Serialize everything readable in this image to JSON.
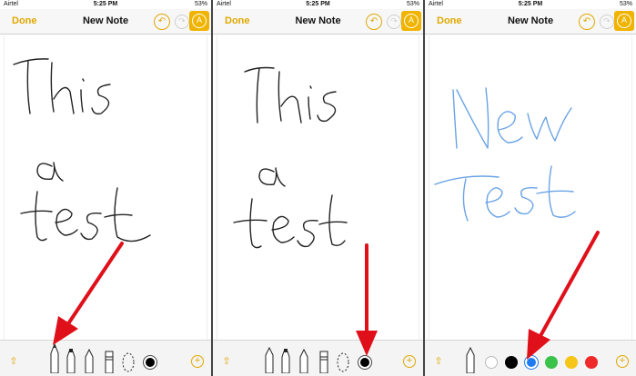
{
  "status": {
    "carrier": "Airtel",
    "time": "5:25 PM",
    "battery": "53%"
  },
  "nav": {
    "done_label": "Done",
    "title": "New Note",
    "undo_glyph": "↶",
    "redo_glyph": "↷",
    "markup_glyph": "A"
  },
  "toolbar": {
    "share_glyph": "⇧",
    "plus_glyph": "+"
  },
  "panels": [
    {
      "handwriting": [
        "This",
        "a",
        "test"
      ],
      "ink_color": "#222222"
    },
    {
      "handwriting": [
        "This",
        "a",
        "test"
      ],
      "ink_color": "#222222"
    },
    {
      "handwriting": [
        "New",
        "Test"
      ],
      "ink_color": "#6aa3e6"
    }
  ],
  "palette": [
    "#ffffff",
    "#000000",
    "#1e7bf0",
    "#3ac24a",
    "#f5c518",
    "#ee2a2a"
  ],
  "colors": {
    "accent": "#f0b400",
    "arrow": "#e0101a"
  }
}
